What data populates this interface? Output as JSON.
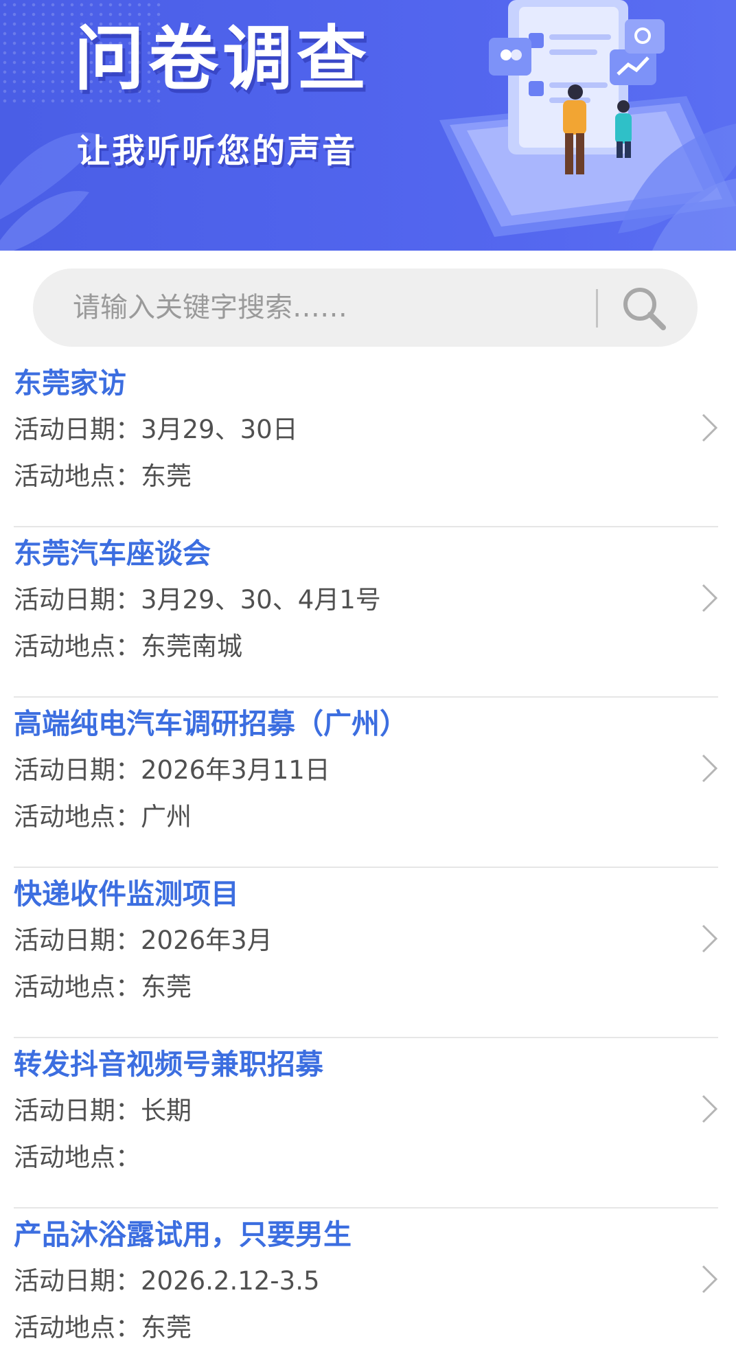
{
  "banner": {
    "title": "问卷调查",
    "subtitle": "让我听听您的声音"
  },
  "search": {
    "placeholder": "请输入关键字搜索……",
    "icon": "search-icon"
  },
  "colors": {
    "banner_blue": "#4f63ec",
    "title_blue": "#3c6ee0",
    "text_gray": "#505050",
    "search_bg": "#efefef"
  },
  "activities": [
    {
      "title": "东莞家访",
      "date": "活动日期：3月29、30日",
      "place": "活动地点：东莞"
    },
    {
      "title": "东莞汽车座谈会",
      "date": "活动日期：3月29、30、4月1号",
      "place": "活动地点：东莞南城"
    },
    {
      "title": "高端纯电汽车调研招募（广州）",
      "date": "活动日期：2026年3月11日",
      "place": "活动地点：广州"
    },
    {
      "title": "快递收件监测项目",
      "date": "活动日期：2026年3月",
      "place": "活动地点：东莞"
    },
    {
      "title": "转发抖音视频号兼职招募",
      "date": "活动日期：长期",
      "place": "活动地点："
    },
    {
      "title": "产品沐浴露试用，只要男生",
      "date": "活动日期：2026.2.12-3.5",
      "place": "活动地点：东莞"
    }
  ]
}
